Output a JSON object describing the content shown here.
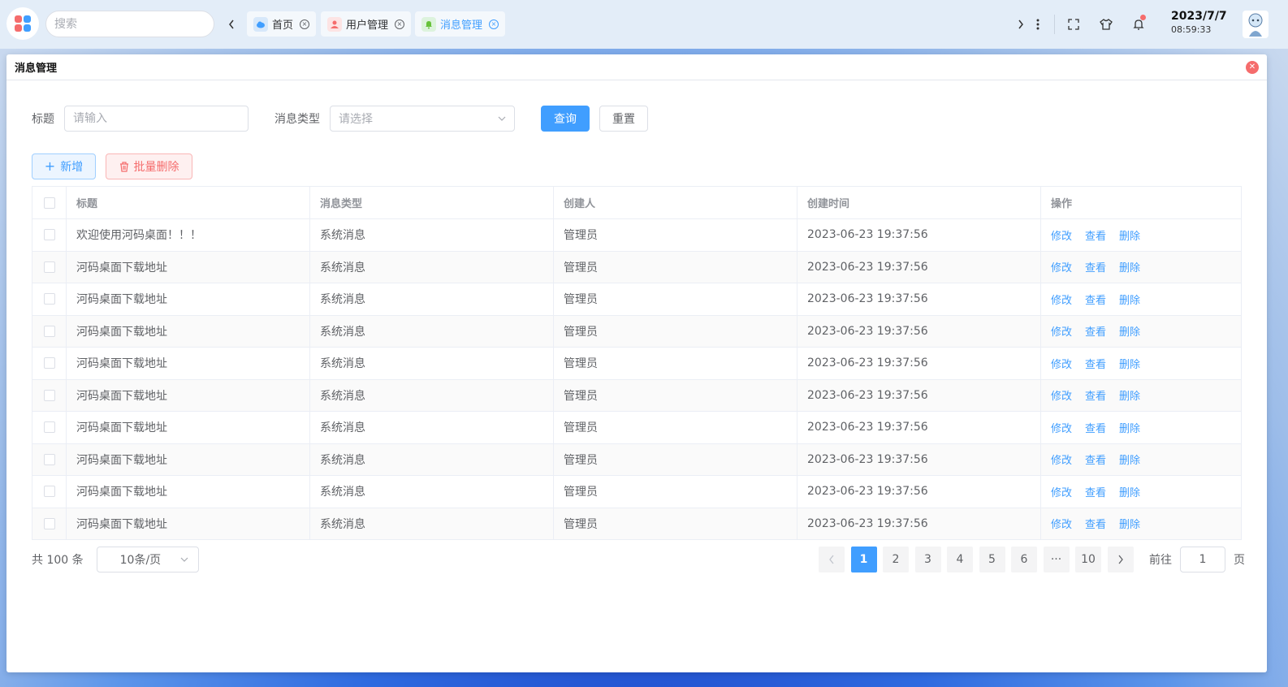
{
  "taskbar": {
    "search_placeholder": "搜索",
    "tabs": [
      {
        "label": "首页",
        "icon": "cloud-icon",
        "active": false
      },
      {
        "label": "用户管理",
        "icon": "user-icon",
        "active": false
      },
      {
        "label": "消息管理",
        "icon": "bell-icon",
        "active": true
      }
    ],
    "date": "2023/7/7",
    "time": "08:59:33",
    "colors": {
      "accent": "#409eff",
      "notification_dot": "#f56c6c"
    }
  },
  "window": {
    "title": "消息管理"
  },
  "filter": {
    "title_label": "标题",
    "title_placeholder": "请输入",
    "type_label": "消息类型",
    "type_placeholder": "请选择",
    "query_label": "查询",
    "reset_label": "重置"
  },
  "toolbar": {
    "add_label": "新增",
    "batch_delete_label": "批量删除"
  },
  "table": {
    "columns": [
      "标题",
      "消息类型",
      "创建人",
      "创建时间",
      "操作"
    ],
    "op_labels": {
      "edit": "修改",
      "view": "查看",
      "delete": "删除"
    },
    "rows": [
      {
        "title": "欢迎使用河码桌面！！！",
        "type": "系统消息",
        "creator": "管理员",
        "created": "2023-06-23 19:37:56"
      },
      {
        "title": "河码桌面下载地址",
        "type": "系统消息",
        "creator": "管理员",
        "created": "2023-06-23 19:37:56"
      },
      {
        "title": "河码桌面下载地址",
        "type": "系统消息",
        "creator": "管理员",
        "created": "2023-06-23 19:37:56"
      },
      {
        "title": "河码桌面下载地址",
        "type": "系统消息",
        "creator": "管理员",
        "created": "2023-06-23 19:37:56"
      },
      {
        "title": "河码桌面下载地址",
        "type": "系统消息",
        "creator": "管理员",
        "created": "2023-06-23 19:37:56"
      },
      {
        "title": "河码桌面下载地址",
        "type": "系统消息",
        "creator": "管理员",
        "created": "2023-06-23 19:37:56"
      },
      {
        "title": "河码桌面下载地址",
        "type": "系统消息",
        "creator": "管理员",
        "created": "2023-06-23 19:37:56"
      },
      {
        "title": "河码桌面下载地址",
        "type": "系统消息",
        "creator": "管理员",
        "created": "2023-06-23 19:37:56"
      },
      {
        "title": "河码桌面下载地址",
        "type": "系统消息",
        "creator": "管理员",
        "created": "2023-06-23 19:37:56"
      },
      {
        "title": "河码桌面下载地址",
        "type": "系统消息",
        "creator": "管理员",
        "created": "2023-06-23 19:37:56"
      }
    ]
  },
  "pagination": {
    "total_text": "共 100 条",
    "page_size": "10条/页",
    "pages": [
      "1",
      "2",
      "3",
      "4",
      "5",
      "6"
    ],
    "ellipsis": "···",
    "last_page": "10",
    "current": "1",
    "goto_prefix": "前往",
    "goto_value": "1",
    "goto_suffix": "页"
  }
}
